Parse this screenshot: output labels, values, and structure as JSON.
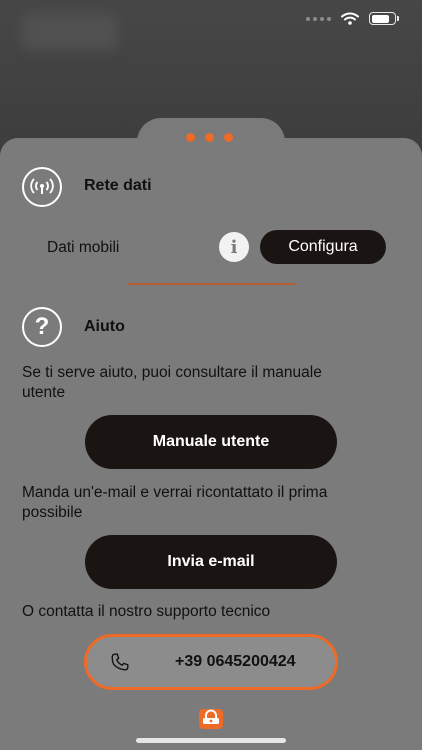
{
  "status_bar": {
    "icons": [
      "signal-dots-icon",
      "wifi-icon",
      "battery-icon"
    ],
    "battery_level": 0.8
  },
  "pager": {
    "dots": 3,
    "accent": "#ee6a26"
  },
  "network": {
    "title": "Rete dati",
    "icon": "antenna-icon",
    "row_label": "Dati mobili",
    "info_icon_label": "i",
    "configure_label": "Configura"
  },
  "help": {
    "title": "Aiuto",
    "icon": "question-icon",
    "manual_text": "Se ti serve aiuto, puoi consultare il manuale utente",
    "manual_button": "Manuale utente",
    "email_text": "Manda un'e-mail e verrai ricontattato il prima possibile",
    "email_button": "Invia e-mail",
    "support_text": "O contatta il nostro supporto tecnico",
    "phone_number": "+39 0645200424",
    "phone_icon": "phone-icon"
  },
  "footer": {
    "logo": "brand-logo-icon"
  },
  "colors": {
    "sheet": "#7b7b7b",
    "button_dark": "#1a1512",
    "accent": "#ee6a26"
  }
}
